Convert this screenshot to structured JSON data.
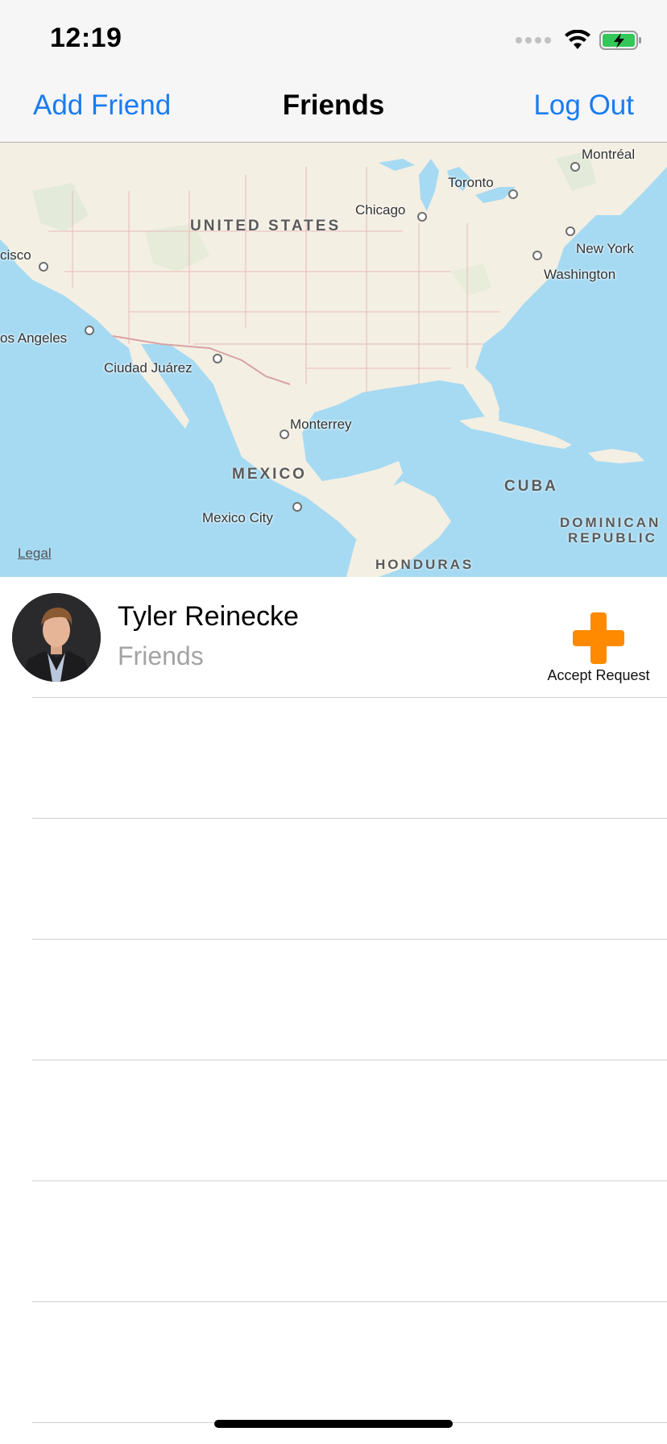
{
  "status_bar": {
    "time": "12:19"
  },
  "nav": {
    "left_label": "Add Friend",
    "title": "Friends",
    "right_label": "Log Out"
  },
  "map": {
    "legal_label": "Legal",
    "countries": [
      "UNITED STATES",
      "MEXICO",
      "CUBA",
      "DOMINICAN",
      "REPUBLIC",
      "HONDURAS"
    ],
    "cities": [
      "Montréal",
      "Toronto",
      "Chicago",
      "New York",
      "Washington",
      "cisco",
      "os Angeles",
      "Ciudad Juárez",
      "Monterrey",
      "Mexico City"
    ]
  },
  "friends": [
    {
      "name": "Tyler Reinecke",
      "status": "Friends",
      "action_label": "Accept Request"
    }
  ],
  "colors": {
    "accent": "#1a7cf0",
    "action": "#ff8a00",
    "water": "#a6daf2",
    "land": "#f4efe3"
  }
}
